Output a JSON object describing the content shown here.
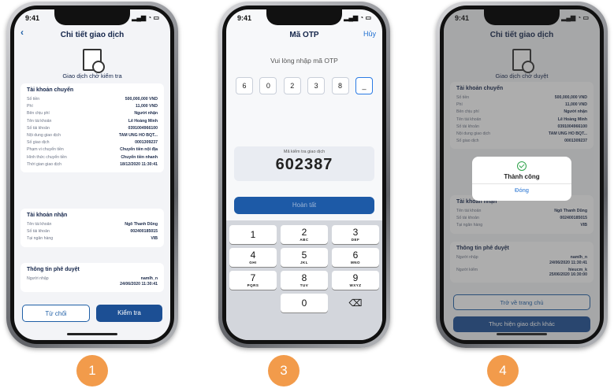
{
  "status_time": "9:41",
  "phone1": {
    "title": "Chi tiết giao dịch",
    "status": "Giao dịch chờ kiểm tra",
    "source": {
      "title": "Tài khoản chuyển",
      "rows": [
        {
          "k": "Số tiền",
          "v": "500,000,000 VND"
        },
        {
          "k": "Phí",
          "v": "11,000 VND"
        },
        {
          "k": "Bên chịu phí",
          "v": "Người nhận"
        },
        {
          "k": "Tên tài khoản",
          "v": "Lê Hoàng Minh"
        },
        {
          "k": "Số tài khoản",
          "v": "0391004966100"
        },
        {
          "k": "Nội dung giao dịch",
          "v": "TAM UNG HO BQT..."
        },
        {
          "k": "Số giao dịch",
          "v": "0001309237"
        },
        {
          "k": "Phạm vi chuyển tiền",
          "v": "Chuyển tiền nội địa"
        },
        {
          "k": "Hình thức chuyển tiền",
          "v": "Chuyển tiền nhanh"
        },
        {
          "k": "Thời gian giao dịch",
          "v": "18/12/2020 11:30:41"
        }
      ]
    },
    "dest": {
      "title": "Tài khoản nhận",
      "rows": [
        {
          "k": "Tên tài khoản",
          "v": "Ngô Thanh Dũng"
        },
        {
          "k": "Số tài khoản",
          "v": "002400185015"
        },
        {
          "k": "Tại ngân hàng",
          "v": "VIB"
        }
      ]
    },
    "approval": {
      "title": "Thông tin phê duyệt",
      "input_label": "Người nhập",
      "input_name": "namlh_n",
      "input_time": "24/06/2020 11:30:41"
    },
    "reject_label": "Từ chối",
    "check_label": "Kiểm tra"
  },
  "phone2": {
    "title": "Mã OTP",
    "cancel": "Hủy",
    "prompt": "Vui lòng nhập mã OTP",
    "otp_digits": [
      "6",
      "0",
      "2",
      "3",
      "8",
      "_"
    ],
    "code_label": "Mã kiểm tra giao dịch",
    "code": "602387",
    "done_label": "Hoàn tất",
    "keys": [
      {
        "d": "1",
        "l": ""
      },
      {
        "d": "2",
        "l": "ABC"
      },
      {
        "d": "3",
        "l": "DEF"
      },
      {
        "d": "4",
        "l": "GHI"
      },
      {
        "d": "5",
        "l": "JKL"
      },
      {
        "d": "6",
        "l": "MNO"
      },
      {
        "d": "7",
        "l": "PQRS"
      },
      {
        "d": "8",
        "l": "TUV"
      },
      {
        "d": "9",
        "l": "WXYZ"
      },
      {
        "d": "0",
        "l": ""
      },
      {
        "d": "⌫",
        "l": ""
      }
    ]
  },
  "phone3": {
    "title": "Chi tiết giao dịch",
    "status": "Giao dịch chờ duyệt",
    "source": {
      "title": "Tài khoản chuyển",
      "rows": [
        {
          "k": "Số tiền",
          "v": "500,000,000 VND"
        },
        {
          "k": "Phí",
          "v": "11,000 VND"
        },
        {
          "k": "Bên chịu phí",
          "v": "Người nhận"
        },
        {
          "k": "Tên tài khoản",
          "v": "Lê Hoàng Minh"
        },
        {
          "k": "Số tài khoản",
          "v": "0391004966100"
        },
        {
          "k": "Nội dung giao dịch",
          "v": "TAM UNG HO BQT..."
        },
        {
          "k": "Số giao dịch",
          "v": "0001309237"
        }
      ]
    },
    "dest": {
      "title": "Tài khoản nhận",
      "rows": [
        {
          "k": "Tên tài khoản",
          "v": "Ngô Thanh Dũng"
        },
        {
          "k": "Số tài khoản",
          "v": "002400185015"
        },
        {
          "k": "Tại ngân hàng",
          "v": "VIB"
        }
      ]
    },
    "approval": {
      "title": "Thông tin phê duyệt",
      "input_label": "Người nhập",
      "input_name": "namlh_n",
      "input_time": "24/06/2020 11:30:41",
      "check_label": "Người kiểm",
      "check_name": "hieucm_k",
      "check_time": "25/06/2020 16:30:00"
    },
    "dialog_message": "Thành công",
    "dialog_ok": "Đóng",
    "home_label": "Trở về trang chủ",
    "other_label": "Thực hiện giao dịch khác"
  },
  "badges": [
    "1",
    "3",
    "4"
  ],
  "colors": {
    "primary": "#1c4f94",
    "badge": "#f29b4b",
    "success": "#2ea34a"
  }
}
